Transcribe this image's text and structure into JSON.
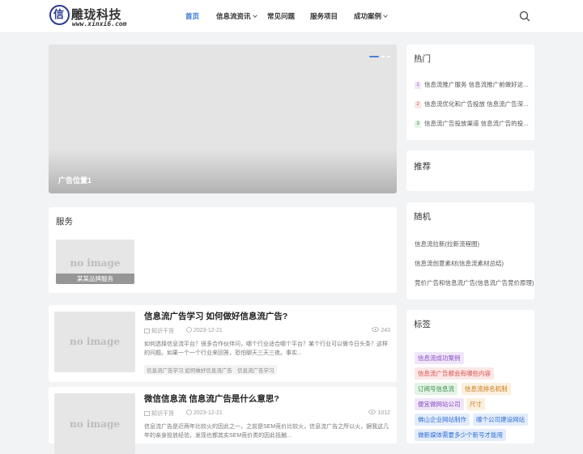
{
  "header": {
    "logo_text": "雕珑科技",
    "logo_mark": "信",
    "logo_url": "www.xinxi6.com",
    "nav": [
      {
        "label": "首页",
        "active": true,
        "dropdown": false
      },
      {
        "label": "信息流资讯",
        "active": false,
        "dropdown": true
      },
      {
        "label": "常见问题",
        "active": false,
        "dropdown": false
      },
      {
        "label": "服务项目",
        "active": false,
        "dropdown": false
      },
      {
        "label": "成功案例",
        "active": false,
        "dropdown": true
      }
    ],
    "search_icon": "search-icon"
  },
  "banner": {
    "caption": "广告位置1"
  },
  "services": {
    "title": "服务",
    "items": [
      {
        "thumb_text": "no image",
        "label": "某某品牌服务"
      }
    ]
  },
  "posts": [
    {
      "title": "信息流广告学习 如何做好信息流广告?",
      "category": "知识干货",
      "date": "2023-12-21",
      "views": "243",
      "excerpt": "如何选择信息流平台？很多合作伙伴问，哪个行业适合哪个平台？某个行业可以做今日头条？这样的问题。如果一个一个行业来回答，恐怕聊天三天三夜。事实...",
      "tags": [
        "信息流广告学习 如何做好信息流广告",
        "信息流广告学习"
      ],
      "thumb_text": "no image"
    },
    {
      "title": "微信信息流 信息流广告是什么意思?",
      "category": "知识干货",
      "date": "2023-12-21",
      "views": "1012",
      "excerpt": "信息流广告是近两年比较火的因此之一，之前是SEM竞价比较火，信息流广告之所以火，据我这几年的亲身投放经验，发现也都其实SEM竞价类的因此抵触...",
      "tags": [],
      "thumb_text": "no image"
    }
  ],
  "sidebar": {
    "hot": {
      "title": "热门",
      "items": [
        {
          "num": "1",
          "text": "信息流推广服务 信息流推广前做好这..."
        },
        {
          "num": "2",
          "text": "信息流优化和广告投放 信息流广告深..."
        },
        {
          "num": "3",
          "text": "信息流广告投放渠道 信息流广告的投..."
        }
      ]
    },
    "recommend": {
      "title": "推荐"
    },
    "random": {
      "title": "随机",
      "items": [
        "信息流拉新(拉新流程图)",
        "信息流创意素材(信息流素材总结)",
        "竞价广告和信息流广告(信息流广告竞价原理)"
      ]
    },
    "tags": {
      "title": "标签",
      "items": [
        {
          "label": "信息流成功案例",
          "color": "#8a4fc7",
          "bg": "#efe6f8"
        },
        {
          "label": "信息流广告都会有哪些内容",
          "color": "#d9534f",
          "bg": "#fbe7e6"
        },
        {
          "label": "订阅号信息流",
          "color": "#3a8f4a",
          "bg": "#e3f3e6"
        },
        {
          "label": "信息流排名机制",
          "color": "#c77a1a",
          "bg": "#fbefdd"
        },
        {
          "label": "便宜做网站公司",
          "color": "#8a4fc7",
          "bg": "#efe6f8"
        },
        {
          "label": "尺寸",
          "color": "#c77a1a",
          "bg": "#fbefdd"
        },
        {
          "label": "佛山企业网站制作",
          "color": "#2f6fd6",
          "bg": "#e3ecfa"
        },
        {
          "label": "哪个公司建设网站",
          "color": "#2f6fd6",
          "bg": "#e3ecfa"
        },
        {
          "label": "做新媒体需要多少个新号才能用",
          "color": "#2f6fd6",
          "bg": "#e3ecfa"
        }
      ]
    }
  },
  "colors": {
    "accent": "#2f6fd6",
    "background": "#f2f3f5",
    "brand": "#2b3a8f"
  }
}
